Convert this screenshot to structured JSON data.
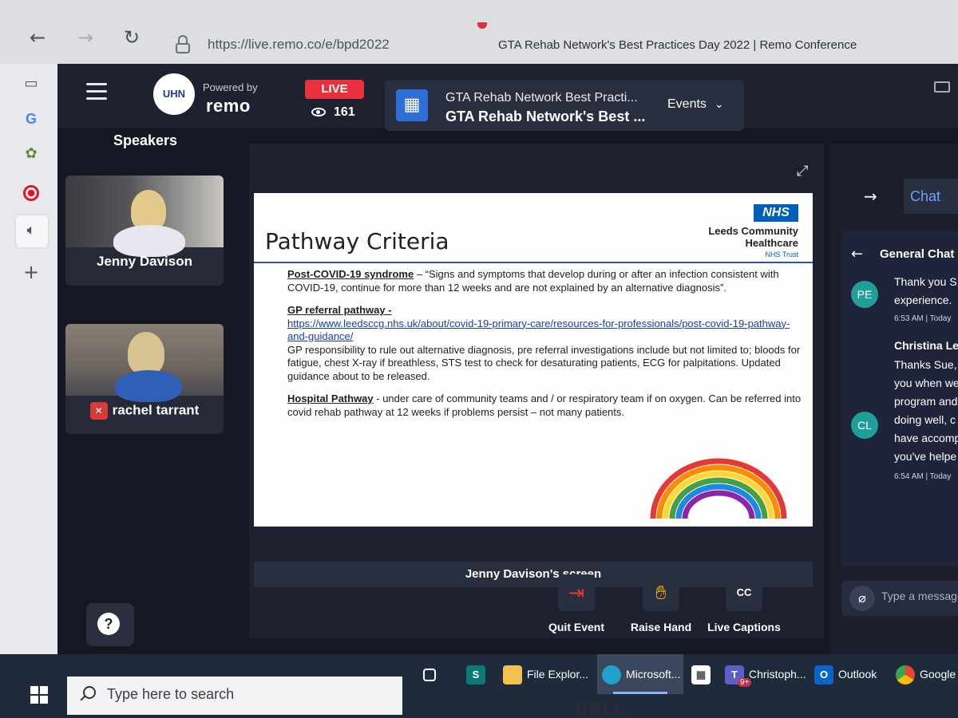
{
  "browser": {
    "back_icon": "←",
    "forward_icon": "→",
    "reload_icon": "↻",
    "url": "https://live.remo.co/e/bpd2022",
    "tab_title": "GTA Rehab Network's Best Practices Day 2022 | Remo Conference"
  },
  "header": {
    "logo_text": "UHN",
    "powered_by": "Powered by",
    "brand": "remo",
    "live_badge": "LIVE",
    "viewer_count": "161",
    "event_title_1": "GTA Rehab Network Best Practi...",
    "event_title_2": "GTA Rehab Network's Best ...",
    "events_label": "Events"
  },
  "speakers": {
    "title": "Speakers",
    "items": [
      {
        "name": "Jenny Davison"
      },
      {
        "name": "rachel tarrant"
      }
    ]
  },
  "slide": {
    "title": "Pathway Criteria",
    "nhs_badge": "NHS",
    "org_line1": "Leeds Community",
    "org_line2": "Healthcare",
    "org_line3": "NHS Trust",
    "p1_head": "Post-COVID-19 syndrome",
    "p1_body": " – “Signs and symptoms that develop during or after an infection consistent with COVID-19, continue for more than 12 weeks and are not explained by an alternative diagnosis”.",
    "p2_head": "GP referral pathway -",
    "p2_link": "https://www.leedsccg.nhs.uk/about/covid-19-primary-care/resources-for-professionals/post-covid-19-pathway-and-guidance/",
    "p2_body": "GP responsibility to rule out alternative diagnosis, pre referral investigations include but not limited to; bloods for fatigue, chest X-ray if breathless, STS test to check for desaturating patients, ECG for palpitations. Updated guidance about to be released.",
    "p3_head": "Hospital Pathway",
    "p3_body": " -  under care of community teams and / or respiratory team if on oxygen. Can be referred into covid rehab pathway at 12 weeks if problems persist – not many patients."
  },
  "screen_label": "Jenny Davison's screen",
  "controls": {
    "quit": "Quit Event",
    "raise_hand": "Raise Hand",
    "captions": "Live Captions",
    "captions_icon": "CC"
  },
  "help_icon_text": "?",
  "chat": {
    "tab": "Chat",
    "channel": "General Chat",
    "messages": [
      {
        "initials": "PE",
        "line1": "Thank you S",
        "line2": "experience.",
        "time": "6:53 AM | Today"
      },
      {
        "initials": "CL",
        "sender": "Christina Lee",
        "lines": [
          "Thanks Sue,",
          "you when we",
          "program and",
          "doing well, c",
          "have accomp",
          "you've helpe"
        ],
        "time": "6:54 AM | Today"
      }
    ],
    "input_placeholder": "Type a message"
  },
  "taskbar": {
    "search_placeholder": "Type here to search",
    "items": [
      {
        "label": "File Explor..."
      },
      {
        "label": "Microsoft..."
      },
      {
        "label": "Christoph..."
      },
      {
        "label": "Outlook"
      },
      {
        "label": "Google C..."
      }
    ],
    "teams_badge": "9+"
  },
  "monitor_brand": "DELL",
  "colors": {
    "accent": "#2f6fd6",
    "live": "#e8313a",
    "chat_accent": "#6f9cff",
    "nhs_blue": "#005eb8"
  }
}
